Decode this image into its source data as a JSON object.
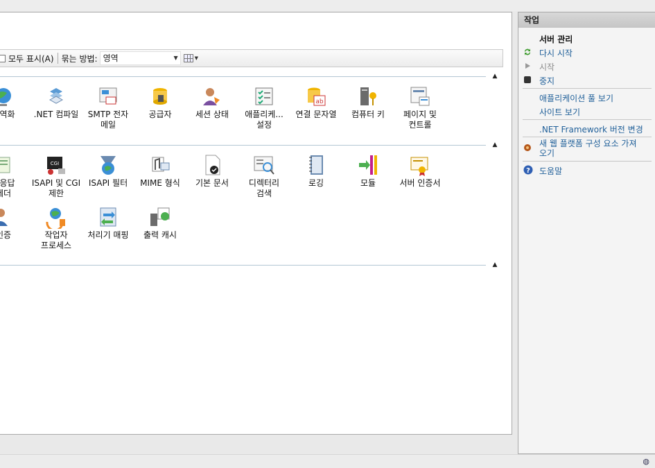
{
  "toolbar": {
    "show_all": "모두 표시(A)",
    "group_by_label": "묶는 방법:",
    "group_by_value": "영역"
  },
  "features": {
    "row1": [
      "전역화",
      ".NET 컴파일",
      "SMTP 전자\n메일",
      "공급자",
      "세션 상태",
      "애플리케...\n설정",
      "연결 문자열",
      "컴퓨터 키",
      "페이지 및\n컨트롤"
    ],
    "row2": [
      "P 응답\n헤더",
      "ISAPI 및 CGI\n제한",
      "ISAPI 필터",
      "MIME 형식",
      "기본 문서",
      "디렉터리\n검색",
      "로깅",
      "모듈",
      "서버 인증서"
    ],
    "row3": [
      "인증",
      "작업자\n프로세스",
      "처리기 매핑",
      "출력 캐시"
    ]
  },
  "actions": {
    "title": "작업",
    "server_manage": "서버 관리",
    "restart": "다시 시작",
    "start": "시작",
    "stop": "중지",
    "view_app_pools": "애플리케이션 풀 보기",
    "view_sites": "사이트 보기",
    "net_version": ".NET Framework 버전 변경",
    "get_components": "새 웹 플랫폼 구성 요소 가져\n오기",
    "help": "도움말"
  }
}
